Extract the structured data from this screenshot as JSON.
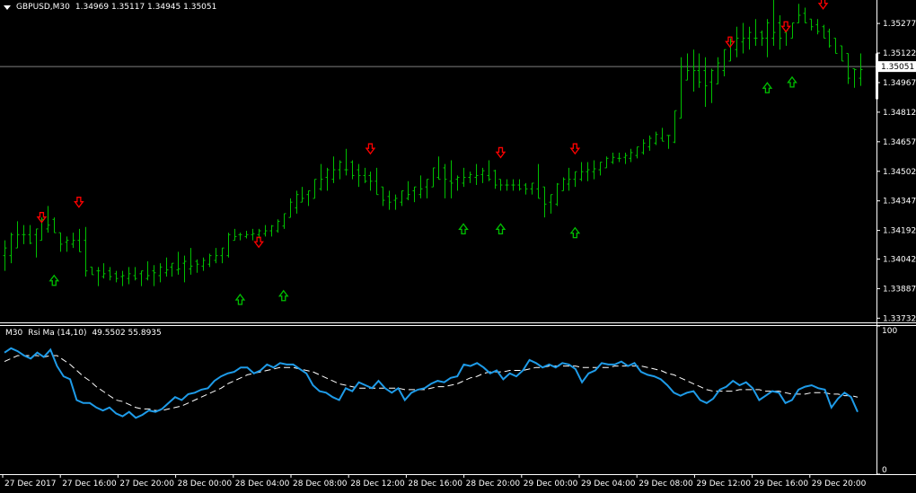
{
  "header": {
    "symbol": "GBPUSD,M30",
    "ohlc": "1.34969 1.35117 1.34945 1.35051"
  },
  "indicator": {
    "label": "M30",
    "name": "Rsi Ma (14,10)",
    "values": "49.5502 55.8935"
  },
  "colors": {
    "background": "#000000",
    "candles": "#00c000",
    "rsi_line": "#1e9be8",
    "ma_line": "#ffffff",
    "price_line": "#808080",
    "down_arrow": "#ff0000",
    "up_arrow": "#00c000",
    "axis": "#ffffff"
  },
  "icons": {
    "up_arrow": "hollow-up-arrow-icon",
    "down_arrow": "hollow-down-arrow-icon",
    "menu": "triangle-down-icon"
  },
  "chart_data": [
    {
      "type": "bar",
      "title": "GBPUSD,M30",
      "price_axis_ticks": [
        "1.35277",
        "1.35122",
        "1.35051",
        "1.34967",
        "1.34812",
        "1.34657",
        "1.34502",
        "1.34347",
        "1.34192",
        "1.34042",
        "1.33887",
        "1.33732"
      ],
      "current_price": "1.35051",
      "ylim": [
        1.3371,
        1.354
      ],
      "time_ticks": [
        "27 Dec 2017",
        "27 Dec 16:00",
        "27 Dec 20:00",
        "28 Dec 00:00",
        "28 Dec 04:00",
        "28 Dec 08:00",
        "28 Dec 12:00",
        "28 Dec 16:00",
        "28 Dec 20:00",
        "29 Dec 00:00",
        "29 Dec 04:00",
        "29 Dec 08:00",
        "29 Dec 12:00",
        "29 Dec 16:00",
        "29 Dec 20:00"
      ],
      "bars": [
        [
          1.3414,
          1.3398
        ],
        [
          1.3418,
          1.3402
        ],
        [
          1.3424,
          1.341
        ],
        [
          1.3422,
          1.3412
        ],
        [
          1.3422,
          1.3412
        ],
        [
          1.342,
          1.3405
        ],
        [
          1.3426,
          1.3414
        ],
        [
          1.3432,
          1.3418
        ],
        [
          1.3426,
          1.3418
        ],
        [
          1.3418,
          1.3408
        ],
        [
          1.3416,
          1.3408
        ],
        [
          1.3418,
          1.341
        ],
        [
          1.342,
          1.3408
        ],
        [
          1.3421,
          1.3395
        ],
        [
          1.34,
          1.3396
        ],
        [
          1.34,
          1.339
        ],
        [
          1.3402,
          1.3394
        ],
        [
          1.34,
          1.3393
        ],
        [
          1.3398,
          1.3392
        ],
        [
          1.3398,
          1.339
        ],
        [
          1.34,
          1.3391
        ],
        [
          1.34,
          1.3393
        ],
        [
          1.3398,
          1.339
        ],
        [
          1.3403,
          1.3393
        ],
        [
          1.3401,
          1.339
        ],
        [
          1.3402,
          1.3392
        ],
        [
          1.3405,
          1.3395
        ],
        [
          1.3402,
          1.3395
        ],
        [
          1.3408,
          1.3396
        ],
        [
          1.3406,
          1.3392
        ],
        [
          1.341,
          1.3396
        ],
        [
          1.3404,
          1.3397
        ],
        [
          1.3405,
          1.3398
        ],
        [
          1.3407,
          1.34
        ],
        [
          1.341,
          1.3402
        ],
        [
          1.341,
          1.3402
        ],
        [
          1.3418,
          1.3405
        ],
        [
          1.342,
          1.3414
        ],
        [
          1.3418,
          1.3414
        ],
        [
          1.3419,
          1.3415
        ],
        [
          1.342,
          1.3414
        ],
        [
          1.342,
          1.3415
        ],
        [
          1.3422,
          1.3416
        ],
        [
          1.3422,
          1.3416
        ],
        [
          1.3425,
          1.3418
        ],
        [
          1.3428,
          1.342
        ],
        [
          1.3436,
          1.3426
        ],
        [
          1.344,
          1.3428
        ],
        [
          1.3442,
          1.3434
        ],
        [
          1.344,
          1.3432
        ],
        [
          1.3446,
          1.3436
        ],
        [
          1.3454,
          1.344
        ],
        [
          1.3452,
          1.344
        ],
        [
          1.3458,
          1.3444
        ],
        [
          1.3456,
          1.3446
        ],
        [
          1.3462,
          1.3448
        ],
        [
          1.3456,
          1.3446
        ],
        [
          1.3454,
          1.3442
        ],
        [
          1.3452,
          1.3444
        ],
        [
          1.345,
          1.344
        ],
        [
          1.3452,
          1.3438
        ],
        [
          1.3442,
          1.3432
        ],
        [
          1.344,
          1.343
        ],
        [
          1.3438,
          1.343
        ],
        [
          1.344,
          1.3432
        ],
        [
          1.3445,
          1.3435
        ],
        [
          1.3442,
          1.3434
        ],
        [
          1.3448,
          1.3436
        ],
        [
          1.3446,
          1.3436
        ],
        [
          1.3452,
          1.3442
        ],
        [
          1.3458,
          1.3446
        ],
        [
          1.3454,
          1.3436
        ],
        [
          1.3456,
          1.3436
        ],
        [
          1.3448,
          1.344
        ],
        [
          1.3452,
          1.3442
        ],
        [
          1.345,
          1.3444
        ],
        [
          1.3454,
          1.3443
        ],
        [
          1.3452,
          1.3444
        ],
        [
          1.3456,
          1.3445
        ],
        [
          1.3451,
          1.3441
        ],
        [
          1.3446,
          1.344
        ],
        [
          1.3446,
          1.344
        ],
        [
          1.3446,
          1.344
        ],
        [
          1.3446,
          1.344
        ],
        [
          1.3444,
          1.3438
        ],
        [
          1.3444,
          1.3438
        ],
        [
          1.3454,
          1.3436
        ],
        [
          1.3442,
          1.3426
        ],
        [
          1.3438,
          1.3428
        ],
        [
          1.3444,
          1.3432
        ],
        [
          1.3447,
          1.344
        ],
        [
          1.3452,
          1.344
        ],
        [
          1.345,
          1.3442
        ],
        [
          1.3455,
          1.3445
        ],
        [
          1.3455,
          1.3445
        ],
        [
          1.3456,
          1.3446
        ],
        [
          1.3455,
          1.3448
        ],
        [
          1.3458,
          1.3452
        ],
        [
          1.346,
          1.3454
        ],
        [
          1.346,
          1.3455
        ],
        [
          1.346,
          1.3454
        ],
        [
          1.3462,
          1.3455
        ],
        [
          1.3463,
          1.3457
        ],
        [
          1.3467,
          1.3459
        ],
        [
          1.3469,
          1.3461
        ],
        [
          1.3471,
          1.3464
        ],
        [
          1.3473,
          1.3466
        ],
        [
          1.3469,
          1.3462
        ],
        [
          1.3482,
          1.3465
        ],
        [
          1.351,
          1.3478
        ],
        [
          1.3512,
          1.3498
        ],
        [
          1.3514,
          1.3492
        ],
        [
          1.3512,
          1.3494
        ],
        [
          1.351,
          1.3484
        ],
        [
          1.3504,
          1.3486
        ],
        [
          1.351,
          1.3496
        ],
        [
          1.3514,
          1.35
        ],
        [
          1.352,
          1.3508
        ],
        [
          1.3526,
          1.351
        ],
        [
          1.3528,
          1.3512
        ],
        [
          1.3526,
          1.3514
        ],
        [
          1.353,
          1.3516
        ],
        [
          1.3524,
          1.3516
        ],
        [
          1.353,
          1.351
        ],
        [
          1.354,
          1.3516
        ],
        [
          1.3532,
          1.3514
        ],
        [
          1.3524,
          1.3516
        ],
        [
          1.3528,
          1.352
        ],
        [
          1.3538,
          1.3528
        ],
        [
          1.3536,
          1.3528
        ],
        [
          1.353,
          1.3524
        ],
        [
          1.353,
          1.3522
        ],
        [
          1.3527,
          1.352
        ],
        [
          1.3525,
          1.3515
        ],
        [
          1.352,
          1.3512
        ],
        [
          1.3516,
          1.3508
        ],
        [
          1.3512,
          1.3496
        ],
        [
          1.3504,
          1.3494
        ],
        [
          1.3512,
          1.3495
        ]
      ],
      "down_arrows": [
        1.3426,
        1.3434,
        1.3413,
        1.3462,
        1.346,
        1.3462,
        1.3518,
        1.3526,
        1.3538
      ],
      "up_arrows": [
        1.3393,
        1.3383,
        1.3385,
        1.342,
        1.342,
        1.3418,
        1.3494,
        1.3497
      ],
      "down_arrow_bars": [
        6,
        12,
        41,
        59,
        80,
        92,
        117,
        126,
        132
      ],
      "up_arrow_bars": [
        8,
        38,
        45,
        74,
        80,
        92,
        123,
        127
      ]
    },
    {
      "type": "line",
      "title": "Rsi Ma (14,10)",
      "ylim": [
        0,
        100
      ],
      "y_ticks": [
        "100",
        "0"
      ],
      "series": [
        {
          "name": "Rsi",
          "values": [
            82,
            85,
            83,
            80,
            78,
            82,
            79,
            84,
            73,
            66,
            64,
            50,
            48,
            48,
            45,
            43,
            45,
            41,
            39,
            42,
            38,
            40,
            43,
            42,
            44,
            48,
            52,
            50,
            54,
            55,
            57,
            58,
            63,
            66,
            68,
            69,
            72,
            72,
            68,
            70,
            74,
            72,
            75,
            74,
            74,
            71,
            68,
            60,
            56,
            55,
            52,
            50,
            58,
            56,
            62,
            60,
            58,
            63,
            58,
            55,
            58,
            50,
            55,
            57,
            58,
            61,
            63,
            62,
            65,
            66,
            74,
            73,
            75,
            72,
            68,
            70,
            64,
            68,
            66,
            70,
            77,
            75,
            72,
            74,
            72,
            75,
            74,
            71,
            62,
            68,
            70,
            75,
            74,
            74,
            76,
            73,
            75,
            69,
            67,
            66,
            64,
            60,
            55,
            53,
            55,
            56,
            50,
            48,
            51,
            57,
            59,
            63,
            60,
            62,
            58,
            50,
            53,
            56,
            55,
            48,
            50,
            57,
            59,
            60,
            58,
            57,
            45,
            51,
            55,
            52,
            42
          ]
        },
        {
          "name": "Ma",
          "values": [
            76,
            78,
            80,
            80,
            80,
            80,
            79,
            80,
            80,
            77,
            74,
            70,
            66,
            63,
            59,
            56,
            53,
            50,
            49,
            47,
            45,
            44,
            44,
            43,
            43,
            44,
            45,
            46,
            48,
            50,
            52,
            54,
            56,
            58,
            61,
            63,
            65,
            67,
            68,
            69,
            70,
            71,
            72,
            72,
            72,
            71,
            70,
            69,
            67,
            65,
            63,
            61,
            60,
            59,
            58,
            58,
            58,
            58,
            58,
            58,
            58,
            57,
            57,
            57,
            57,
            58,
            59,
            59,
            60,
            61,
            63,
            65,
            66,
            68,
            69,
            69,
            69,
            70,
            70,
            70,
            71,
            72,
            72,
            73,
            73,
            73,
            73,
            73,
            72,
            72,
            72,
            72,
            72,
            73,
            73,
            73,
            73,
            73,
            72,
            71,
            70,
            68,
            67,
            65,
            63,
            61,
            59,
            57,
            56,
            56,
            56,
            56,
            57,
            57,
            57,
            57,
            56,
            56,
            56,
            55,
            54,
            54,
            54,
            55,
            55,
            55,
            54,
            54,
            53,
            53,
            52
          ]
        }
      ]
    }
  ]
}
